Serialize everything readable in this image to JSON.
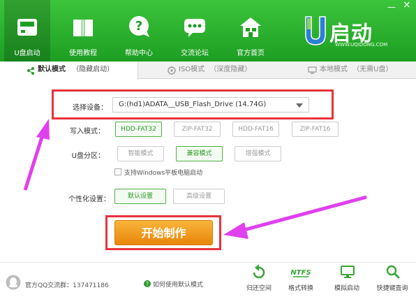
{
  "window": {
    "minimize": "—",
    "close": "×"
  },
  "nav": [
    {
      "label": "U盘启动",
      "icon": "usb-drive-icon"
    },
    {
      "label": "使用教程",
      "icon": "book-icon"
    },
    {
      "label": "帮助中心",
      "icon": "question-icon"
    },
    {
      "label": "交流论坛",
      "icon": "chat-bubble-icon"
    },
    {
      "label": "官方首页",
      "icon": "home-icon"
    }
  ],
  "logo": {
    "text": "U启动",
    "url": "WWW.UQIDONG.COM"
  },
  "tabs": [
    {
      "label": "默认模式",
      "note": "（隐藏启动）"
    },
    {
      "label": "ISO模式",
      "note": "（深度隐藏）"
    },
    {
      "label": "本地模式",
      "note": "（无需U盘）"
    }
  ],
  "form": {
    "device_label": "选择设备：",
    "device_value": "G:(hd1)ADATA__USB_Flash_Drive (14.74G)",
    "write_mode_label": "写入模式：",
    "write_modes": [
      "HDD-FAT32",
      "ZIP-FAT32",
      "HDD-FAT16",
      "ZIP-FAT16"
    ],
    "partition_label": "U盘分区：",
    "partitions": [
      "智能模式",
      "兼容模式",
      "增强模式"
    ],
    "tablet_checkbox": "支持Windows平板电脑启动",
    "personalize_label": "个性化设置：",
    "personalize": [
      "默认设置",
      "高级设置"
    ],
    "start_button": "开始制作"
  },
  "footer": {
    "qq_group": "官方QQ交流群：137471186",
    "help_link": "如何使用默认模式",
    "tools": [
      {
        "label": "归还空间",
        "icon": "restore-icon"
      },
      {
        "label": "格式转换",
        "icon": "ntfs-icon",
        "badge": "NTFS"
      },
      {
        "label": "模拟启动",
        "icon": "monitor-icon"
      },
      {
        "label": "快捷键查询",
        "icon": "search-icon"
      }
    ]
  },
  "colors": {
    "header": "#2aae2a",
    "accent": "#e8323c",
    "arrow": "#e040ee",
    "start": "#f0a020"
  }
}
